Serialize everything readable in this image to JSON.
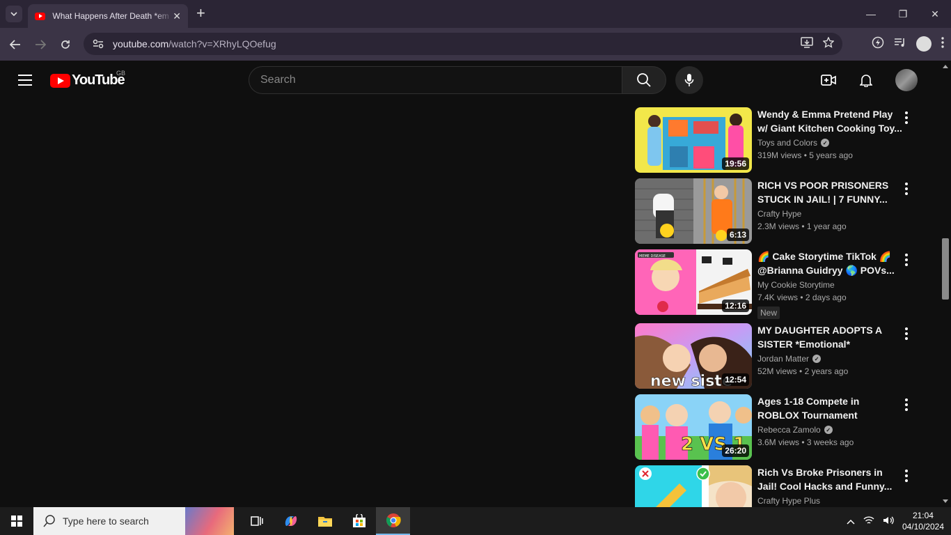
{
  "browser": {
    "tab_title": "What Happens After Death *em",
    "url_host": "youtube.com",
    "url_path": "/watch?v=XRhyLQOefug"
  },
  "youtube": {
    "logo_text": "YouTube",
    "country_code": "GB",
    "search_placeholder": "Search"
  },
  "videos": [
    {
      "title": "Wendy & Emma Pretend Play w/ Giant Kitchen Cooking Toy...",
      "channel": "Toys and Colors",
      "verified": true,
      "views": "319M views",
      "age": "5 years ago",
      "duration": "19:56",
      "badge": ""
    },
    {
      "title": "RICH VS POOR PRISONERS STUCK IN JAIL! | 7 FUNNY...",
      "channel": "Crafty Hype",
      "verified": false,
      "views": "2.3M views",
      "age": "1 year ago",
      "duration": "6:13",
      "badge": ""
    },
    {
      "title": "🌈 Cake Storytime TikTok 🌈 @Brianna Guidryy 🌎 POVs...",
      "channel": "My Cookie Storytime",
      "verified": false,
      "views": "7.4K views",
      "age": "2 days ago",
      "duration": "12:16",
      "badge": "New"
    },
    {
      "title": "MY DAUGHTER ADOPTS A SISTER *Emotional*",
      "channel": "Jordan Matter",
      "verified": true,
      "views": "52M views",
      "age": "2 years ago",
      "duration": "12:54",
      "badge": ""
    },
    {
      "title": "Ages 1-18 Compete in ROBLOX Tournament",
      "channel": "Rebecca Zamolo",
      "verified": true,
      "views": "3.6M views",
      "age": "3 weeks ago",
      "duration": "26:20",
      "badge": ""
    },
    {
      "title": "Rich Vs Broke Prisoners in Jail! Cool Hacks and Funny...",
      "channel": "Crafty Hype Plus",
      "verified": false,
      "views": "",
      "age": "",
      "duration": "",
      "badge": ""
    }
  ],
  "thumb_overlay_text": {
    "v3": "MEME DISEASE",
    "v4": "new siste",
    "v5": "2 VS 1"
  },
  "taskbar": {
    "search_placeholder": "Type here to search",
    "time": "21:04",
    "date": "04/10/2024"
  },
  "colors": {
    "yt_red": "#ff0000",
    "bg": "#0f0f0f",
    "chrome_frame": "#2b2535",
    "chrome_toolbar": "#3b3446"
  }
}
